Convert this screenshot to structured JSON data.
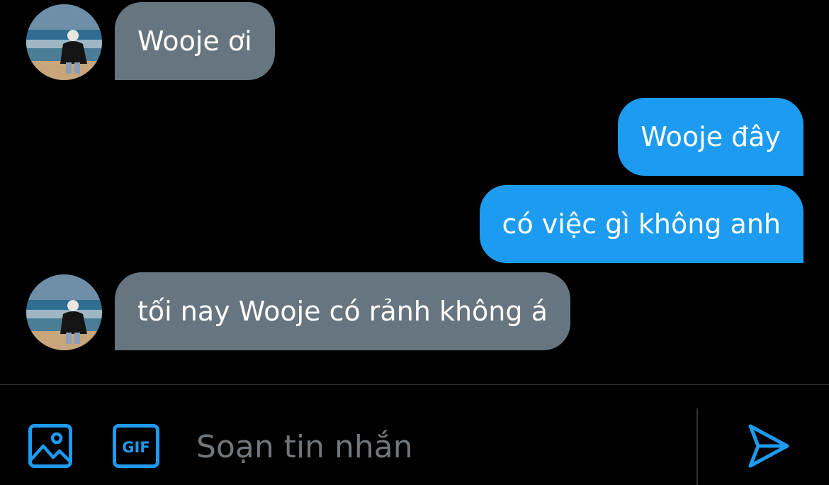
{
  "conversation": {
    "messages": [
      {
        "direction": "incoming",
        "text": "Wooje ơi",
        "has_avatar": true
      },
      {
        "direction": "outgoing",
        "text": "Wooje đây"
      },
      {
        "direction": "outgoing",
        "text": "có việc gì không anh"
      },
      {
        "direction": "incoming",
        "text": "tối nay Wooje có rảnh không á",
        "has_avatar": true
      }
    ]
  },
  "composer": {
    "placeholder": "Soạn tin nhắn",
    "value": "",
    "media_icon": "image-icon",
    "gif_icon": "gif-icon",
    "gif_label": "GIF",
    "send_icon": "send-icon"
  },
  "colors": {
    "background": "#000000",
    "incoming_bubble": "#66757f",
    "outgoing_bubble": "#1d9bf0",
    "accent": "#1d9bf0",
    "placeholder": "#71767b",
    "divider": "#2f3336"
  }
}
